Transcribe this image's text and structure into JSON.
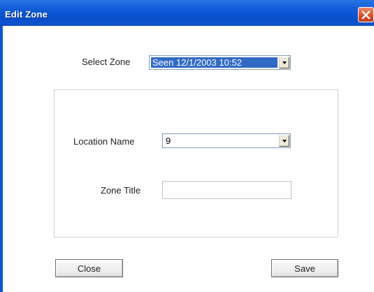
{
  "window": {
    "title": "Edit Zone"
  },
  "select_zone": {
    "label": "Select Zone",
    "selected_value": "Seen 12/1/2003 10:52"
  },
  "location_name": {
    "label": "Location Name",
    "selected_value": "9"
  },
  "zone_title": {
    "label": "Zone Title",
    "value": ""
  },
  "buttons": {
    "close_label": "Close",
    "save_label": "Save"
  },
  "icons": {
    "window_close": "close-icon",
    "dropdown": "chevron-down-icon"
  },
  "colors": {
    "titlebar": "#0f5ad6",
    "close_button": "#d94a25",
    "selection_highlight": "#316ac5"
  }
}
